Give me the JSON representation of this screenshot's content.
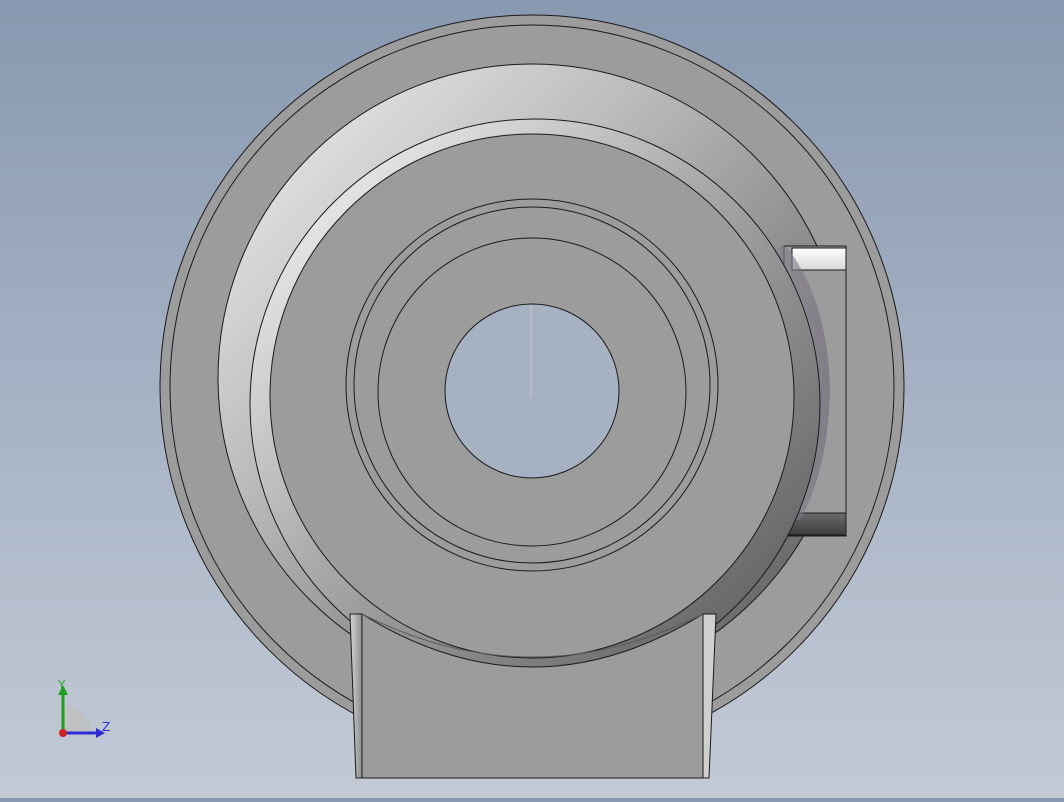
{
  "viewport": {
    "view": "3d-model-viewport",
    "background_colors": [
      "#8798b0",
      "#c3cad6"
    ],
    "model": {
      "type": "pump-housing",
      "body_color": "#9c9c9c",
      "edge_color": "#1a1a1a"
    }
  },
  "triad": {
    "y_label": "Y",
    "z_label": "Z",
    "y_color": "#1fa01f",
    "z_color": "#2b2bd6",
    "x_color": "#d02020"
  }
}
